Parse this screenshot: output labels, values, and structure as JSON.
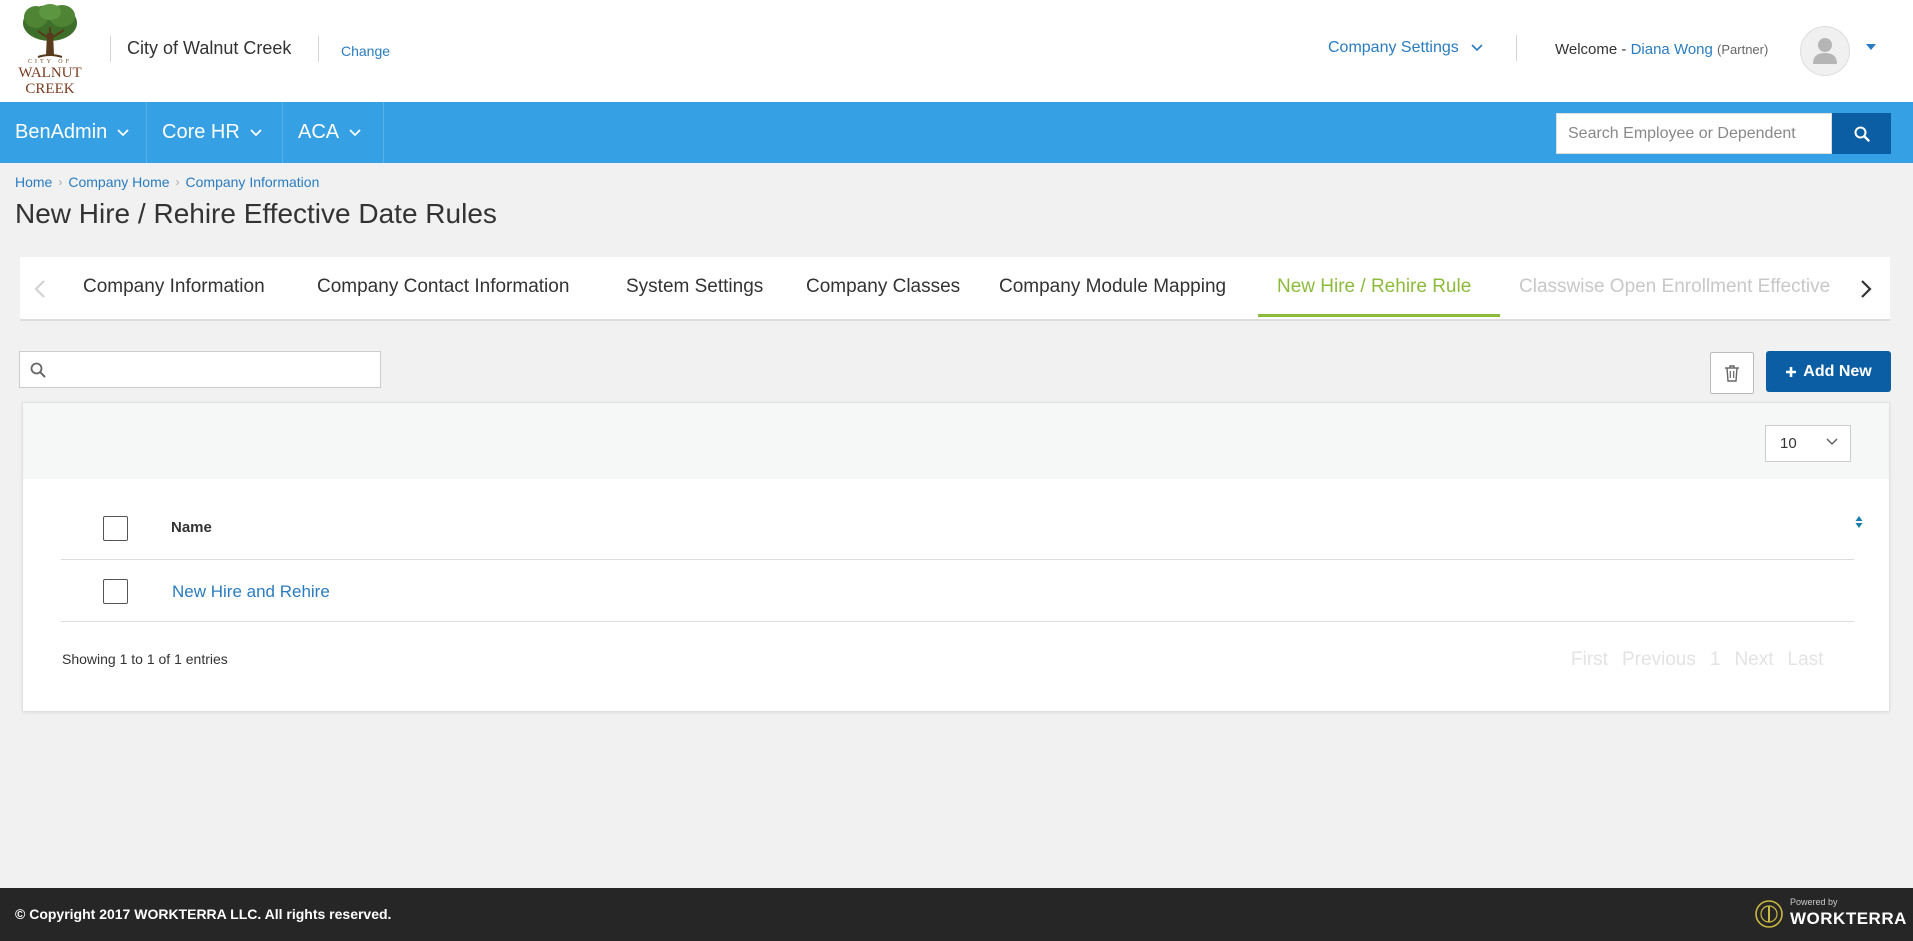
{
  "header": {
    "logo": {
      "city_of": "CITY OF",
      "line1": "WALNUT",
      "line2": "CREEK"
    },
    "company_name": "City of Walnut Creek",
    "change_label": "Change",
    "company_settings_label": "Company Settings",
    "welcome_prefix": "Welcome -",
    "user_name": "Diana Wong",
    "user_role": "(Partner)"
  },
  "nav": {
    "items": [
      {
        "label": "BenAdmin"
      },
      {
        "label": "Core HR"
      },
      {
        "label": "ACA"
      }
    ],
    "search_placeholder": "Search Employee or Dependent"
  },
  "breadcrumb": [
    "Home",
    "Company Home",
    "Company Information"
  ],
  "page_title": "New Hire / Rehire Effective Date Rules",
  "tabs": [
    {
      "label": "Company Information",
      "state": "normal"
    },
    {
      "label": "Company Contact Information",
      "state": "normal"
    },
    {
      "label": "System Settings",
      "state": "normal"
    },
    {
      "label": "Company Classes",
      "state": "normal"
    },
    {
      "label": "Company Module Mapping",
      "state": "normal"
    },
    {
      "label": "New Hire / Rehire Rule",
      "state": "active"
    },
    {
      "label": "Classwise Open Enrollment Effective",
      "state": "disabled"
    }
  ],
  "toolbar": {
    "add_new_label": "Add New"
  },
  "table": {
    "page_size": "10",
    "columns": [
      "Name"
    ],
    "rows": [
      {
        "name": "New Hire and Rehire"
      }
    ],
    "showing_text": "Showing 1 to 1 of 1 entries",
    "pager": [
      "First",
      "Previous",
      "1",
      "Next",
      "Last"
    ]
  },
  "footer": {
    "copyright": "© Copyright 2017 WORKTERRA LLC. All rights reserved.",
    "powered_by": "Powered by",
    "brand": "WORKTERRA"
  },
  "colors": {
    "nav_blue": "#35a0e4",
    "dark_blue": "#0b5ea4",
    "link_blue": "#2a7cc0",
    "active_tab_green": "#8cbb3b",
    "footer_bg": "#262626"
  }
}
